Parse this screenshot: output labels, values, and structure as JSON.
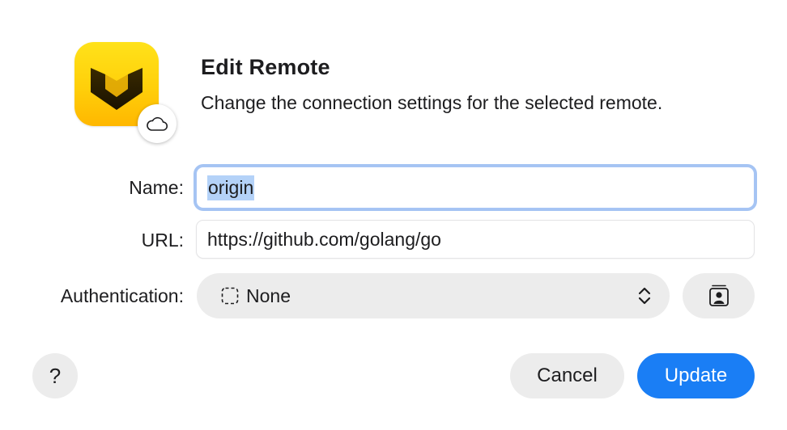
{
  "dialog": {
    "title": "Edit Remote",
    "subtitle": "Change the connection settings for the selected remote."
  },
  "app_icon": {
    "name": "app-logo-icon",
    "badge_icon": "cloud-icon",
    "accent": "#ffd60a"
  },
  "form": {
    "name_label": "Name:",
    "name_value": "origin",
    "url_label": "URL:",
    "url_value": "https://github.com/golang/go",
    "auth_label": "Authentication:",
    "auth_selected": "None",
    "auth_option_icon": "dashed-square-icon",
    "auth_stepper_icon": "chevron-updown-icon",
    "contacts_button_icon": "contact-card-icon"
  },
  "buttons": {
    "help_label": "?",
    "cancel_label": "Cancel",
    "update_label": "Update"
  },
  "colors": {
    "primary": "#1a7ef5",
    "focus_ring": "#a5c4f3",
    "selection": "#b4d2f8",
    "button_gray": "#ececec"
  }
}
